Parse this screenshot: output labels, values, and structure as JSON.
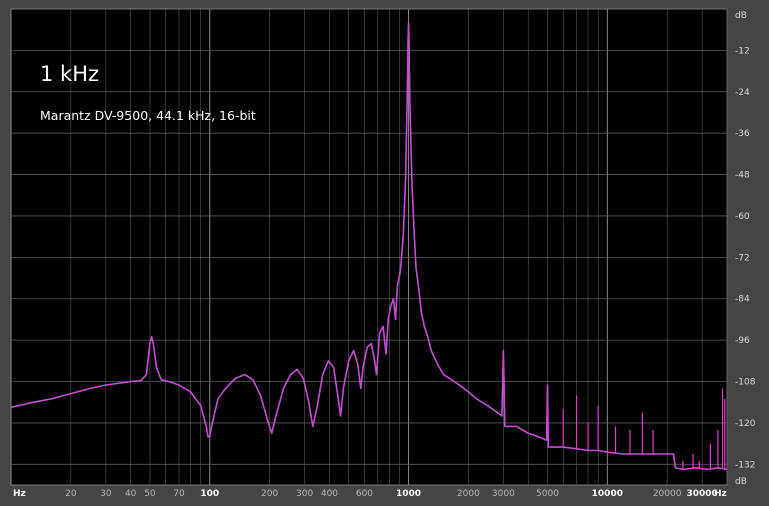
{
  "chart_data": {
    "type": "line",
    "title": "1 kHz",
    "subtitle": "Marantz DV-9500, 44.1 kHz, 16-bit",
    "x_scale": "log",
    "xlim": [
      10,
      40000
    ],
    "ylim": [
      -138,
      0
    ],
    "x_unit": "Hz",
    "y_unit": "dB",
    "x_ticks": [
      {
        "value": 20,
        "label": "20",
        "major": false
      },
      {
        "value": 30,
        "label": "30",
        "major": false
      },
      {
        "value": 40,
        "label": "40",
        "major": false
      },
      {
        "value": 50,
        "label": "50",
        "major": false
      },
      {
        "value": 70,
        "label": "70",
        "major": false
      },
      {
        "value": 100,
        "label": "100",
        "major": true
      },
      {
        "value": 200,
        "label": "200",
        "major": false
      },
      {
        "value": 300,
        "label": "300",
        "major": false
      },
      {
        "value": 400,
        "label": "400",
        "major": false
      },
      {
        "value": 600,
        "label": "600",
        "major": false
      },
      {
        "value": 1000,
        "label": "1000",
        "major": true
      },
      {
        "value": 2000,
        "label": "2000",
        "major": false
      },
      {
        "value": 3000,
        "label": "3000",
        "major": false
      },
      {
        "value": 5000,
        "label": "5000",
        "major": false
      },
      {
        "value": 10000,
        "label": "10000",
        "major": true
      },
      {
        "value": 20000,
        "label": "20000",
        "major": false
      },
      {
        "value": 30000,
        "label": "30000",
        "major": true
      }
    ],
    "y_ticks": [
      -12,
      -24,
      -36,
      -48,
      -60,
      -72,
      -84,
      -96,
      -108,
      -120,
      -132
    ],
    "grid": true,
    "line_color": "#e040c8",
    "line2_color": "#7a78e8",
    "background_color": "#000000",
    "grid_color": "#5a5a5a",
    "series": [
      {
        "points": [
          [
            10,
            -115.5
          ],
          [
            13,
            -114
          ],
          [
            16,
            -113
          ],
          [
            20,
            -111.5
          ],
          [
            25,
            -110
          ],
          [
            30,
            -109
          ],
          [
            35,
            -108.5
          ],
          [
            40,
            -108
          ],
          [
            45,
            -107.8
          ],
          [
            48,
            -106
          ],
          [
            50,
            -97
          ],
          [
            51,
            -95
          ],
          [
            52,
            -97
          ],
          [
            54,
            -104
          ],
          [
            57,
            -107.5
          ],
          [
            62,
            -108
          ],
          [
            70,
            -109
          ],
          [
            80,
            -111
          ],
          [
            90,
            -115
          ],
          [
            96,
            -121
          ],
          [
            98,
            -124
          ],
          [
            100,
            -124
          ],
          [
            102,
            -121
          ],
          [
            110,
            -113
          ],
          [
            120,
            -110
          ],
          [
            135,
            -107
          ],
          [
            150,
            -106
          ],
          [
            165,
            -107.5
          ],
          [
            180,
            -112
          ],
          [
            195,
            -119
          ],
          [
            205,
            -123
          ],
          [
            215,
            -118
          ],
          [
            235,
            -110
          ],
          [
            255,
            -106
          ],
          [
            275,
            -104.5
          ],
          [
            295,
            -107
          ],
          [
            315,
            -114
          ],
          [
            330,
            -121
          ],
          [
            345,
            -116
          ],
          [
            370,
            -106
          ],
          [
            395,
            -102
          ],
          [
            420,
            -104
          ],
          [
            440,
            -112
          ],
          [
            455,
            -118
          ],
          [
            470,
            -110
          ],
          [
            500,
            -102
          ],
          [
            530,
            -99
          ],
          [
            555,
            -103
          ],
          [
            575,
            -110
          ],
          [
            590,
            -104
          ],
          [
            620,
            -98
          ],
          [
            650,
            -97
          ],
          [
            675,
            -102
          ],
          [
            690,
            -106
          ],
          [
            715,
            -94
          ],
          [
            745,
            -92
          ],
          [
            770,
            -100
          ],
          [
            790,
            -90
          ],
          [
            815,
            -86
          ],
          [
            840,
            -84
          ],
          [
            860,
            -90
          ],
          [
            880,
            -80
          ],
          [
            910,
            -76
          ],
          [
            940,
            -66
          ],
          [
            965,
            -50
          ],
          [
            985,
            -26
          ],
          [
            995,
            -9
          ],
          [
            1000,
            -4
          ],
          [
            1005,
            -9
          ],
          [
            1015,
            -26
          ],
          [
            1040,
            -50
          ],
          [
            1065,
            -64
          ],
          [
            1090,
            -75
          ],
          [
            1120,
            -80
          ],
          [
            1160,
            -88
          ],
          [
            1200,
            -92
          ],
          [
            1250,
            -95
          ],
          [
            1300,
            -99
          ],
          [
            1400,
            -103
          ],
          [
            1500,
            -106
          ],
          [
            1600,
            -107
          ],
          [
            1800,
            -109
          ],
          [
            2000,
            -111
          ],
          [
            2200,
            -113
          ],
          [
            2500,
            -115
          ],
          [
            2800,
            -117
          ],
          [
            2950,
            -118
          ],
          [
            3000,
            -99
          ],
          [
            3050,
            -121
          ],
          [
            3500,
            -121
          ],
          [
            4000,
            -123
          ],
          [
            4500,
            -124
          ],
          [
            4950,
            -125
          ],
          [
            5000,
            -109
          ],
          [
            5050,
            -127
          ],
          [
            6000,
            -127
          ],
          [
            7000,
            -127.5
          ],
          [
            8000,
            -128
          ],
          [
            9000,
            -128
          ],
          [
            10000,
            -128.5
          ],
          [
            12000,
            -129
          ],
          [
            15000,
            -129
          ],
          [
            20000,
            -129
          ],
          [
            21500,
            -129
          ],
          [
            22000,
            -133
          ],
          [
            24000,
            -133.5
          ],
          [
            28000,
            -133
          ],
          [
            32000,
            -133.5
          ],
          [
            36000,
            -133
          ],
          [
            40000,
            -133.5
          ]
        ]
      }
    ],
    "spikes": [
      {
        "x": 3000,
        "y": -99
      },
      {
        "x": 5000,
        "y": -109
      },
      {
        "x": 6000,
        "y": -116
      },
      {
        "x": 7000,
        "y": -112
      },
      {
        "x": 8000,
        "y": -120
      },
      {
        "x": 9000,
        "y": -115
      },
      {
        "x": 11000,
        "y": -121
      },
      {
        "x": 13000,
        "y": -122
      },
      {
        "x": 15000,
        "y": -117
      },
      {
        "x": 17000,
        "y": -122
      },
      {
        "x": 24000,
        "y": -131
      },
      {
        "x": 27000,
        "y": -129
      },
      {
        "x": 29000,
        "y": -131
      },
      {
        "x": 33000,
        "y": -126
      },
      {
        "x": 36000,
        "y": -122
      },
      {
        "x": 38000,
        "y": -110
      },
      {
        "x": 39000,
        "y": -113
      }
    ]
  }
}
